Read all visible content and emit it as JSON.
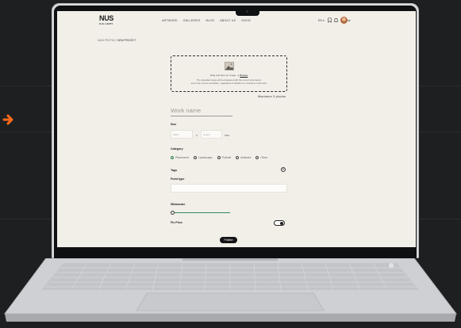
{
  "nav": {
    "logo": "NUS",
    "logo_sub": "GALLERY",
    "links": [
      "ARTWORK",
      "GALLERIES",
      "BLOG",
      "ABOUT US",
      "GOHG"
    ],
    "lang": "EN ▾",
    "icons": [
      "bookmark-icon",
      "bell-icon",
      "avatar"
    ]
  },
  "breadcrumb": {
    "parent": "MAIN PROFILE",
    "current": "NEW PROJECT"
  },
  "upload": {
    "drag_text": "Drag and drop an image, or",
    "browse": "Browse",
    "note_line1": "The uploaded image will be displayed with the correct dimensions",
    "note_line2": "and in the correct orientation, regardless of whether it is vertical or horizontal.",
    "max_photos": "Maximum 3 photos"
  },
  "form": {
    "work_name_placeholder": "Work name",
    "size_label": "Size",
    "width_placeholder": "Width",
    "height_placeholder": "Height",
    "times": "x",
    "unit": "mm",
    "category_label": "Category",
    "categories": [
      "Placement",
      "Landscape",
      "Portrait",
      "Abstract",
      "Other"
    ],
    "selected_category": "Placement",
    "tags_label": "Tags",
    "add_tag": "+",
    "point_type_label": "Point type",
    "point_type_value": "",
    "wildcard_label": "Wildcarder",
    "slider_value": 0,
    "fix_price_label": "Fix Price",
    "fix_price_on": true,
    "publish_label": "Publish"
  },
  "colors": {
    "accent": "#ff6b1a",
    "green": "#2e8b57",
    "screen_bg": "#f2efe9"
  }
}
